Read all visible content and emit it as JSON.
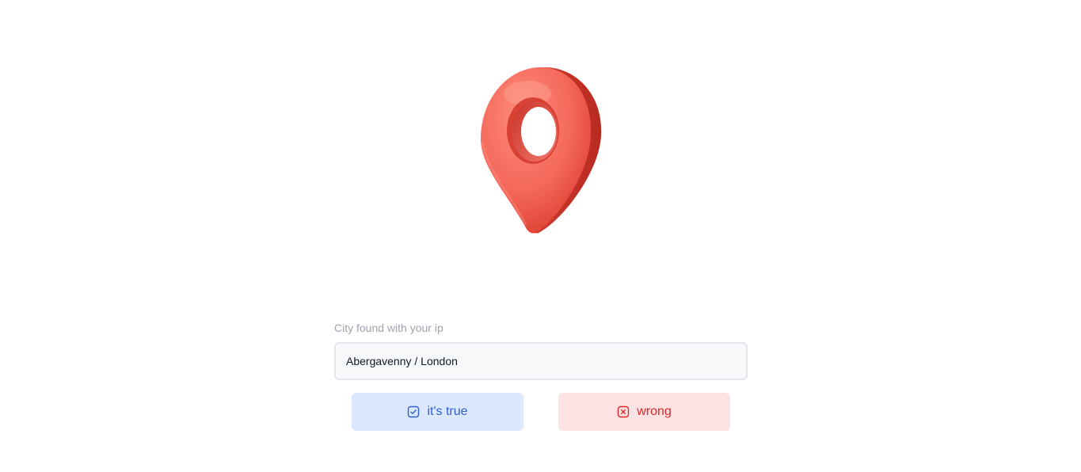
{
  "hero": {
    "icon": "map-pin-icon",
    "pin_color": "#f06a5c"
  },
  "location_form": {
    "label": "City found with your ip",
    "city_value": "Abergavenny / London"
  },
  "actions": {
    "confirm": {
      "label": "it's true",
      "icon": "check-square-icon",
      "color": "#2f5fd0",
      "background": "#dbe8fd"
    },
    "reject": {
      "label": "wrong",
      "icon": "x-square-icon",
      "color": "#dc2626",
      "background": "#fde2e4"
    }
  }
}
